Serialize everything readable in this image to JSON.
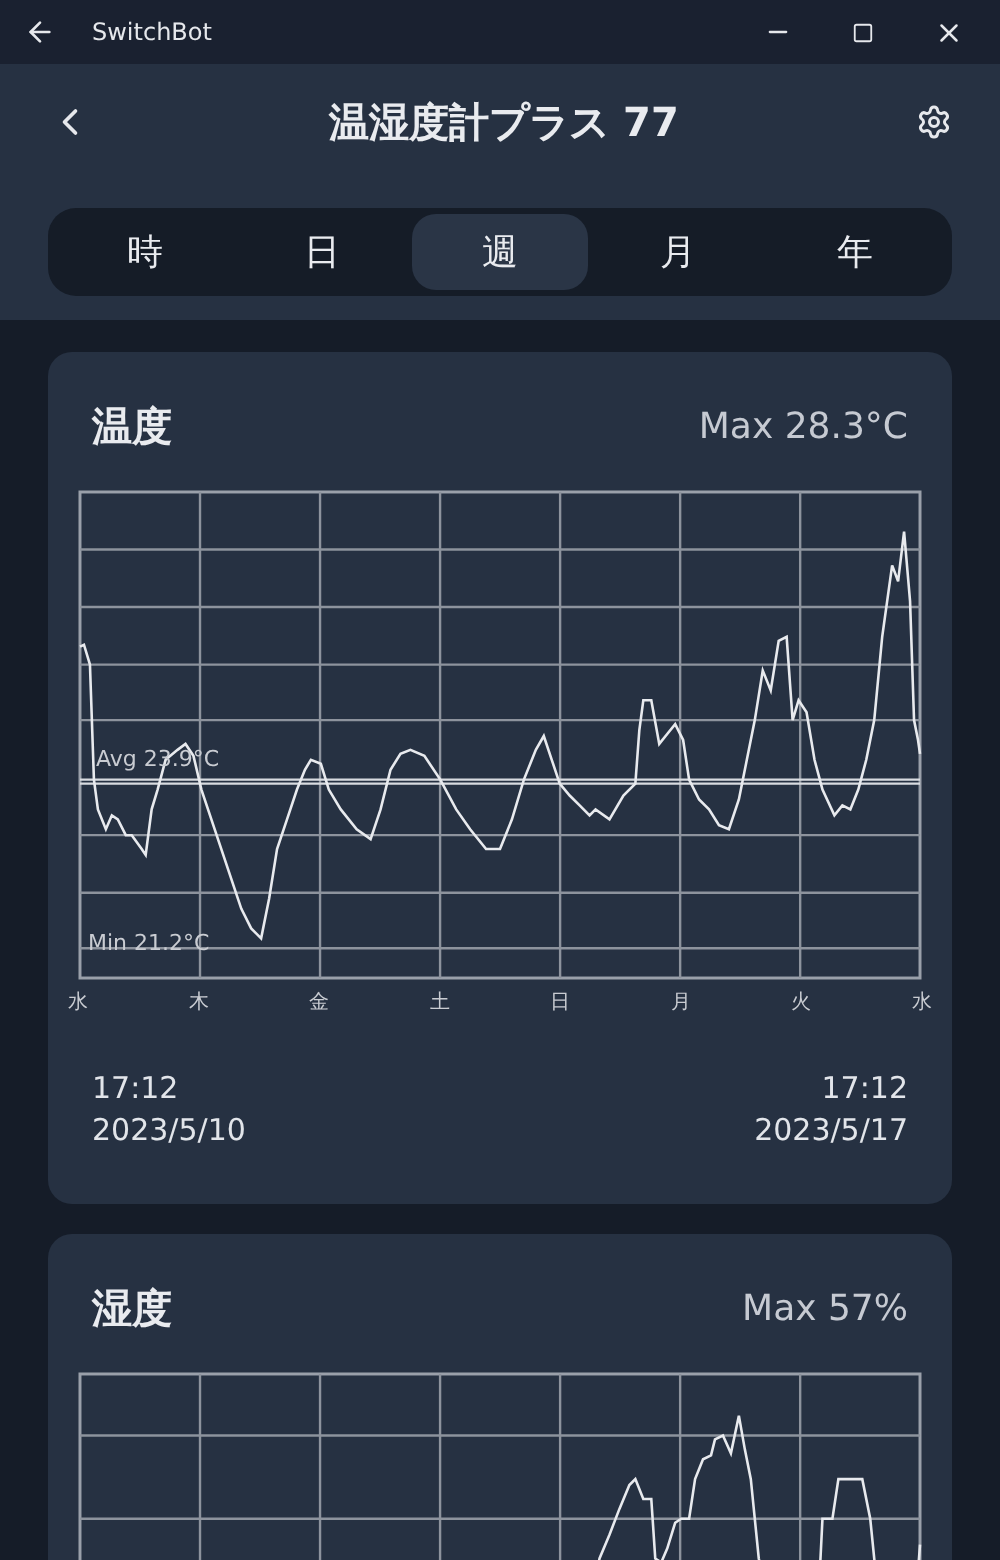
{
  "window": {
    "title": "SwitchBot"
  },
  "header": {
    "title": "温湿度計プラス 77"
  },
  "tabs": [
    {
      "label": "時",
      "selected": false
    },
    {
      "label": "日",
      "selected": false
    },
    {
      "label": "週",
      "selected": true
    },
    {
      "label": "月",
      "selected": false
    },
    {
      "label": "年",
      "selected": false
    }
  ],
  "cards": [
    {
      "kind": "temperature",
      "title": "温度",
      "max": "Max 28.3°C",
      "avg": "Avg 23.9°C",
      "min": "Min 21.2°C",
      "x_labels": [
        "水",
        "木",
        "金",
        "土",
        "日",
        "月",
        "火",
        "水"
      ],
      "start": {
        "time": "17:12",
        "date": "2023/5/10"
      },
      "end": {
        "time": "17:12",
        "date": "2023/5/17"
      }
    },
    {
      "kind": "humidity",
      "title": "湿度",
      "max": "Max 57%"
    }
  ]
}
